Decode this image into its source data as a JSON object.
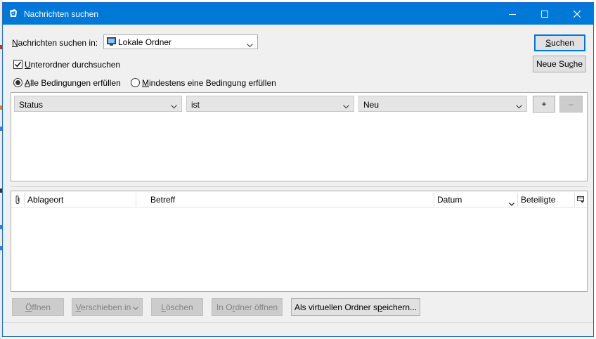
{
  "window": {
    "title": "Nachrichten suchen"
  },
  "search_in": {
    "label": "Nachrichten suchen in:",
    "label_accel": "N",
    "label_rest": "achrichten suchen in:",
    "folder_value": "Lokale Ordner",
    "folder_icon": "monitor-icon"
  },
  "subfolders": {
    "accel": "U",
    "rest": "nterordner durchsuchen",
    "checked": true
  },
  "match": {
    "all_accel": "A",
    "all_rest": "lle Bedingungen erfüllen",
    "any_accel": "M",
    "any_rest": "indestens eine Bedingung erfüllen",
    "selected": "all"
  },
  "buttons": {
    "search_accel": "S",
    "search_rest": "uchen",
    "new_search_pre": "Neue Su",
    "new_search_accel": "c",
    "new_search_post": "he",
    "add": "+",
    "remove": "–"
  },
  "criteria": {
    "rows": [
      {
        "field": "Status",
        "operator": "ist",
        "value": "Neu"
      }
    ]
  },
  "results": {
    "columns": {
      "attachment_icon": "paperclip-icon",
      "location": "Ablageort",
      "subject": "Betreff",
      "date": "Datum",
      "participants": "Beteiligte",
      "picker_icon": "column-picker-icon"
    }
  },
  "actions": {
    "open_accel": "Ö",
    "open_rest": "ffnen",
    "move_accel": "V",
    "move_rest": "erschieben in",
    "delete_accel": "L",
    "delete_rest": "öschen",
    "open_folder_pre": "In O",
    "open_folder_accel": "r",
    "open_folder_post": "dner öffnen",
    "save_virtual_pre": "Als virtuellen Ordner s",
    "save_virtual_accel": "p",
    "save_virtual_post": "eichern..."
  },
  "colors": {
    "titlebar": "#0078d7",
    "accent": "#0078d7"
  }
}
